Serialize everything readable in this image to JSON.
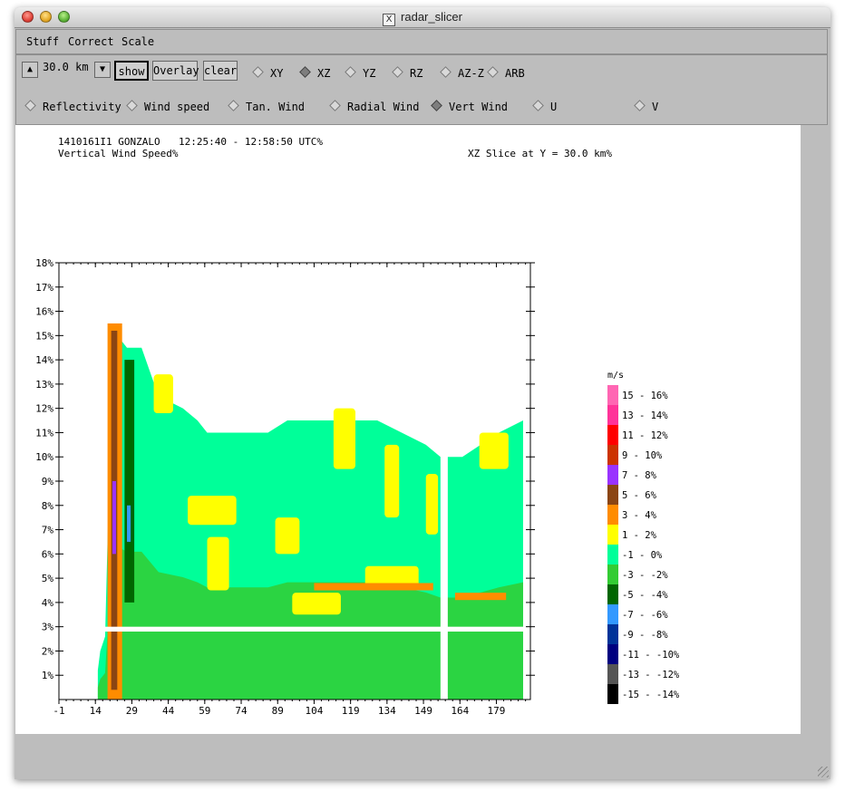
{
  "window": {
    "title": "radar_slicer",
    "x_logo": "X"
  },
  "menu": [
    "Stuff",
    "Correct",
    "Scale"
  ],
  "toolbar": {
    "up_icon": "triangle-up-icon",
    "down_icon": "triangle-down-icon",
    "distance": "30.0 km",
    "show_label": "show",
    "overlay_label": "Overlay",
    "clear_label": "clear",
    "slice_options": [
      "XY",
      "XZ",
      "YZ",
      "RZ",
      "AZ-Z",
      "ARB"
    ],
    "slice_selected": "XZ",
    "field_options": [
      "Reflectivity",
      "Wind speed",
      "Tan. Wind",
      "Radial Wind",
      "Vert Wind",
      "U",
      "V"
    ],
    "field_selected": "Vert Wind"
  },
  "header": {
    "flight": "1410161I1 GONZALO",
    "time": "12:25:40 - 12:58:50 UTC%",
    "field": "Vertical Wind Speed%",
    "slice": "XZ Slice at Y = 30.0 km%"
  },
  "chart_data": {
    "type": "heatmap",
    "x_ticks": [
      "-1",
      "14",
      "29",
      "44",
      "59",
      "74",
      "89",
      "104",
      "119",
      "134",
      "149",
      "164",
      "179"
    ],
    "y_ticks": [
      "1%",
      "2%",
      "3%",
      "4%",
      "5%",
      "6%",
      "7%",
      "8%",
      "9%",
      "10%",
      "11%",
      "12%",
      "13%",
      "14%",
      "15%",
      "16%",
      "17%",
      "18%"
    ],
    "xlim": [
      -1,
      193
    ],
    "ylim": [
      0,
      18
    ],
    "legend": {
      "unit": "m/s",
      "entries": [
        {
          "label": "15 - 16%",
          "color": "#ff66b3"
        },
        {
          "label": "13 - 14%",
          "color": "#ff3399"
        },
        {
          "label": "11 - 12%",
          "color": "#ff0000"
        },
        {
          "label": "9 - 10%",
          "color": "#cc3300"
        },
        {
          "label": "7 - 8%",
          "color": "#9933ff"
        },
        {
          "label": "5 - 6%",
          "color": "#8b4513"
        },
        {
          "label": "3 - 4%",
          "color": "#ff8c00"
        },
        {
          "label": "1 - 2%",
          "color": "#ffff00"
        },
        {
          "label": "-1 - 0%",
          "color": "#00ff99"
        },
        {
          "label": "-3 - -2%",
          "color": "#33cc33"
        },
        {
          "label": "-5 - -4%",
          "color": "#006600"
        },
        {
          "label": "-7 - -6%",
          "color": "#3399ff"
        },
        {
          "label": "-9 - -8%",
          "color": "#003399"
        },
        {
          "label": "-11 - -10%",
          "color": "#000080"
        },
        {
          "label": "-13 - -12%",
          "color": "#555555"
        },
        {
          "label": "-15 - -14%",
          "color": "#000000"
        }
      ]
    },
    "approx_top_height_km": [
      [
        15,
        1.2
      ],
      [
        16,
        2.0
      ],
      [
        18,
        2.6
      ],
      [
        20,
        10.5
      ],
      [
        21,
        15.5
      ],
      [
        23,
        15.0
      ],
      [
        27,
        14.5
      ],
      [
        33,
        14.5
      ],
      [
        40,
        12.5
      ],
      [
        50,
        12.0
      ],
      [
        56,
        11.5
      ],
      [
        60,
        11.0
      ],
      [
        70,
        11.0
      ],
      [
        85,
        11.0
      ],
      [
        93,
        11.5
      ],
      [
        110,
        11.5
      ],
      [
        130,
        11.5
      ],
      [
        150,
        10.5
      ],
      [
        156,
        10.0
      ],
      [
        165,
        10.0
      ],
      [
        180,
        11.0
      ],
      [
        190,
        11.5
      ]
    ],
    "fields_present": [
      "-1 - 0%",
      "-3 - -2%",
      "1 - 2%",
      "3 - 4%",
      "5 - 6%",
      "-5 - -4%",
      "7 - 8%",
      "-7 - -6%"
    ]
  }
}
